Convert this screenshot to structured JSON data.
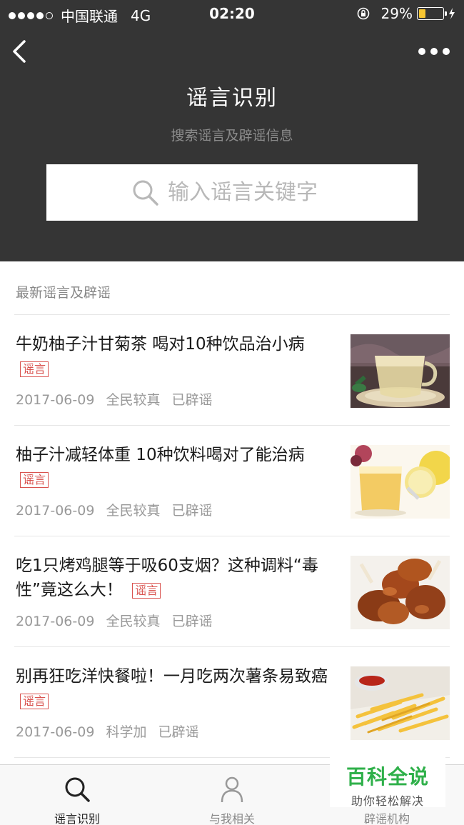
{
  "statusbar": {
    "carrier": "中国联通",
    "network": "4G",
    "time": "02:20",
    "battery_pct": "29%",
    "battery_level": 0.29
  },
  "header": {
    "title": "谣言识别",
    "subtitle": "搜索谣言及辟谣信息",
    "back_icon": "chevron-left-icon",
    "more_icon": "more-dots-icon"
  },
  "search": {
    "placeholder": "输入谣言关键字",
    "icon": "search-icon"
  },
  "section": {
    "title": "最新谣言及辟谣"
  },
  "articles": [
    {
      "title": "牛奶柚子汁甘菊茶 喝对10种饮品治小病",
      "tag": "谣言",
      "date": "2017-06-09",
      "source": "全民较真",
      "status": "已辟谣",
      "image": "tea-cup-photo"
    },
    {
      "title": "柚子汁减轻体重 10种饮料喝对了能治病",
      "tag": "谣言",
      "date": "2017-06-09",
      "source": "全民较真",
      "status": "已辟谣",
      "image": "grapefruit-juice-photo"
    },
    {
      "title": "吃1只烤鸡腿等于吸60支烟？这种调料“毒性”竟这么大！",
      "tag": "谣言",
      "date": "2017-06-09",
      "source": "全民较真",
      "status": "已辟谣",
      "image": "roast-chicken-photo"
    },
    {
      "title": "别再狂吃洋快餐啦！一月吃两次薯条易致癌",
      "tag": "谣言",
      "date": "2017-06-09",
      "source": "科学加",
      "status": "已辟谣",
      "image": "french-fries-photo"
    }
  ],
  "tabbar": {
    "tabs": [
      {
        "label": "谣言识别",
        "icon": "search-icon",
        "active": true
      },
      {
        "label": "与我相关",
        "icon": "person-icon",
        "active": false
      },
      {
        "label": "辟谣机构",
        "icon": "building-icon",
        "active": false
      }
    ]
  },
  "watermark": {
    "brand": "百科全说",
    "slogan": "助你轻松解决"
  },
  "colors": {
    "header_bg": "#353535",
    "tag_red": "#d9534f",
    "battery": "#f7c531",
    "watermark_green": "#2fb04a"
  }
}
